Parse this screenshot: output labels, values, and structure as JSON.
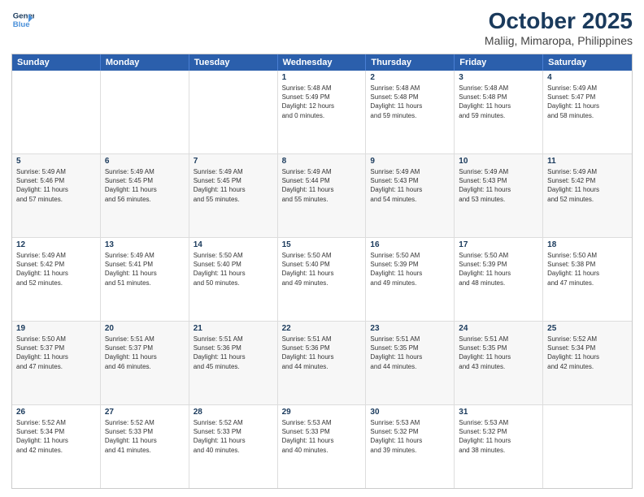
{
  "header": {
    "logo_line1": "General",
    "logo_line2": "Blue",
    "month": "October 2025",
    "location": "Maliig, Mimaropa, Philippines"
  },
  "days_of_week": [
    "Sunday",
    "Monday",
    "Tuesday",
    "Wednesday",
    "Thursday",
    "Friday",
    "Saturday"
  ],
  "weeks": [
    [
      {
        "day": "",
        "lines": []
      },
      {
        "day": "",
        "lines": []
      },
      {
        "day": "",
        "lines": []
      },
      {
        "day": "1",
        "lines": [
          "Sunrise: 5:48 AM",
          "Sunset: 5:49 PM",
          "Daylight: 12 hours",
          "and 0 minutes."
        ]
      },
      {
        "day": "2",
        "lines": [
          "Sunrise: 5:48 AM",
          "Sunset: 5:48 PM",
          "Daylight: 11 hours",
          "and 59 minutes."
        ]
      },
      {
        "day": "3",
        "lines": [
          "Sunrise: 5:48 AM",
          "Sunset: 5:48 PM",
          "Daylight: 11 hours",
          "and 59 minutes."
        ]
      },
      {
        "day": "4",
        "lines": [
          "Sunrise: 5:49 AM",
          "Sunset: 5:47 PM",
          "Daylight: 11 hours",
          "and 58 minutes."
        ]
      }
    ],
    [
      {
        "day": "5",
        "lines": [
          "Sunrise: 5:49 AM",
          "Sunset: 5:46 PM",
          "Daylight: 11 hours",
          "and 57 minutes."
        ]
      },
      {
        "day": "6",
        "lines": [
          "Sunrise: 5:49 AM",
          "Sunset: 5:45 PM",
          "Daylight: 11 hours",
          "and 56 minutes."
        ]
      },
      {
        "day": "7",
        "lines": [
          "Sunrise: 5:49 AM",
          "Sunset: 5:45 PM",
          "Daylight: 11 hours",
          "and 55 minutes."
        ]
      },
      {
        "day": "8",
        "lines": [
          "Sunrise: 5:49 AM",
          "Sunset: 5:44 PM",
          "Daylight: 11 hours",
          "and 55 minutes."
        ]
      },
      {
        "day": "9",
        "lines": [
          "Sunrise: 5:49 AM",
          "Sunset: 5:43 PM",
          "Daylight: 11 hours",
          "and 54 minutes."
        ]
      },
      {
        "day": "10",
        "lines": [
          "Sunrise: 5:49 AM",
          "Sunset: 5:43 PM",
          "Daylight: 11 hours",
          "and 53 minutes."
        ]
      },
      {
        "day": "11",
        "lines": [
          "Sunrise: 5:49 AM",
          "Sunset: 5:42 PM",
          "Daylight: 11 hours",
          "and 52 minutes."
        ]
      }
    ],
    [
      {
        "day": "12",
        "lines": [
          "Sunrise: 5:49 AM",
          "Sunset: 5:42 PM",
          "Daylight: 11 hours",
          "and 52 minutes."
        ]
      },
      {
        "day": "13",
        "lines": [
          "Sunrise: 5:49 AM",
          "Sunset: 5:41 PM",
          "Daylight: 11 hours",
          "and 51 minutes."
        ]
      },
      {
        "day": "14",
        "lines": [
          "Sunrise: 5:50 AM",
          "Sunset: 5:40 PM",
          "Daylight: 11 hours",
          "and 50 minutes."
        ]
      },
      {
        "day": "15",
        "lines": [
          "Sunrise: 5:50 AM",
          "Sunset: 5:40 PM",
          "Daylight: 11 hours",
          "and 49 minutes."
        ]
      },
      {
        "day": "16",
        "lines": [
          "Sunrise: 5:50 AM",
          "Sunset: 5:39 PM",
          "Daylight: 11 hours",
          "and 49 minutes."
        ]
      },
      {
        "day": "17",
        "lines": [
          "Sunrise: 5:50 AM",
          "Sunset: 5:39 PM",
          "Daylight: 11 hours",
          "and 48 minutes."
        ]
      },
      {
        "day": "18",
        "lines": [
          "Sunrise: 5:50 AM",
          "Sunset: 5:38 PM",
          "Daylight: 11 hours",
          "and 47 minutes."
        ]
      }
    ],
    [
      {
        "day": "19",
        "lines": [
          "Sunrise: 5:50 AM",
          "Sunset: 5:37 PM",
          "Daylight: 11 hours",
          "and 47 minutes."
        ]
      },
      {
        "day": "20",
        "lines": [
          "Sunrise: 5:51 AM",
          "Sunset: 5:37 PM",
          "Daylight: 11 hours",
          "and 46 minutes."
        ]
      },
      {
        "day": "21",
        "lines": [
          "Sunrise: 5:51 AM",
          "Sunset: 5:36 PM",
          "Daylight: 11 hours",
          "and 45 minutes."
        ]
      },
      {
        "day": "22",
        "lines": [
          "Sunrise: 5:51 AM",
          "Sunset: 5:36 PM",
          "Daylight: 11 hours",
          "and 44 minutes."
        ]
      },
      {
        "day": "23",
        "lines": [
          "Sunrise: 5:51 AM",
          "Sunset: 5:35 PM",
          "Daylight: 11 hours",
          "and 44 minutes."
        ]
      },
      {
        "day": "24",
        "lines": [
          "Sunrise: 5:51 AM",
          "Sunset: 5:35 PM",
          "Daylight: 11 hours",
          "and 43 minutes."
        ]
      },
      {
        "day": "25",
        "lines": [
          "Sunrise: 5:52 AM",
          "Sunset: 5:34 PM",
          "Daylight: 11 hours",
          "and 42 minutes."
        ]
      }
    ],
    [
      {
        "day": "26",
        "lines": [
          "Sunrise: 5:52 AM",
          "Sunset: 5:34 PM",
          "Daylight: 11 hours",
          "and 42 minutes."
        ]
      },
      {
        "day": "27",
        "lines": [
          "Sunrise: 5:52 AM",
          "Sunset: 5:33 PM",
          "Daylight: 11 hours",
          "and 41 minutes."
        ]
      },
      {
        "day": "28",
        "lines": [
          "Sunrise: 5:52 AM",
          "Sunset: 5:33 PM",
          "Daylight: 11 hours",
          "and 40 minutes."
        ]
      },
      {
        "day": "29",
        "lines": [
          "Sunrise: 5:53 AM",
          "Sunset: 5:33 PM",
          "Daylight: 11 hours",
          "and 40 minutes."
        ]
      },
      {
        "day": "30",
        "lines": [
          "Sunrise: 5:53 AM",
          "Sunset: 5:32 PM",
          "Daylight: 11 hours",
          "and 39 minutes."
        ]
      },
      {
        "day": "31",
        "lines": [
          "Sunrise: 5:53 AM",
          "Sunset: 5:32 PM",
          "Daylight: 11 hours",
          "and 38 minutes."
        ]
      },
      {
        "day": "",
        "lines": []
      }
    ]
  ]
}
